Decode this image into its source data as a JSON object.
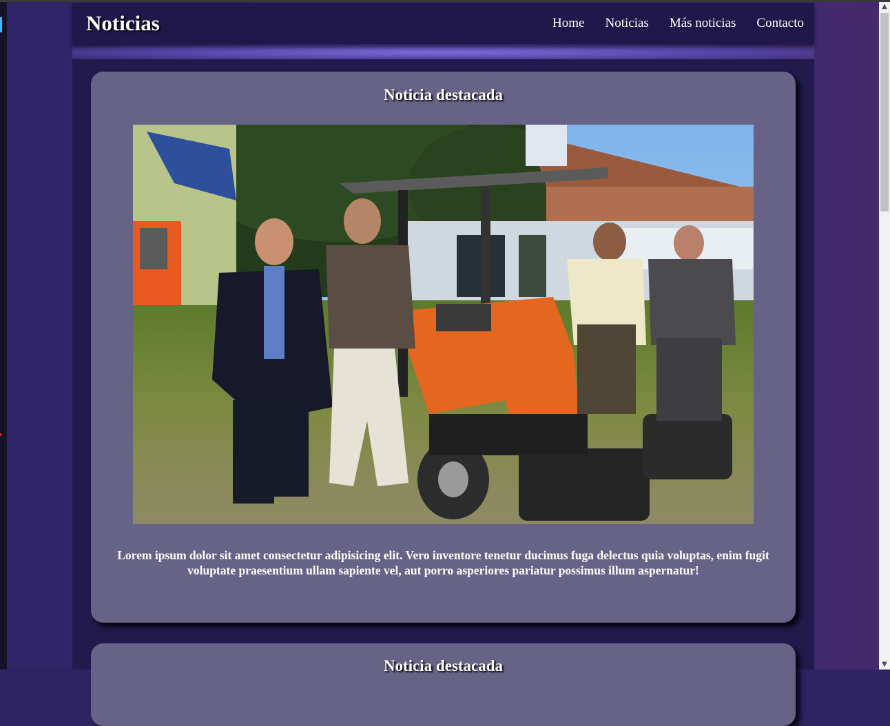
{
  "header": {
    "brand": "Noticias",
    "nav": [
      {
        "label": "Home"
      },
      {
        "label": "Noticias"
      },
      {
        "label": "Más noticias"
      },
      {
        "label": "Contacto"
      }
    ]
  },
  "featured": [
    {
      "title": "Noticia destacada",
      "image": "photo-men-with-orange-mower",
      "text": "Lorem ipsum dolor sit amet consectetur adipisicing elit. Vero inventore tenetur ducimus fuga delectus quia voluptas, enim fugit voluptate praesentium ullam sapiente vel, aut porro asperiores pariatur possimus illum aspernatur!"
    },
    {
      "title": "Noticia destacada"
    }
  ],
  "colors": {
    "navbar": "#20184a",
    "page": "#2e2463",
    "content": "#221a4d",
    "card": "#676387"
  }
}
